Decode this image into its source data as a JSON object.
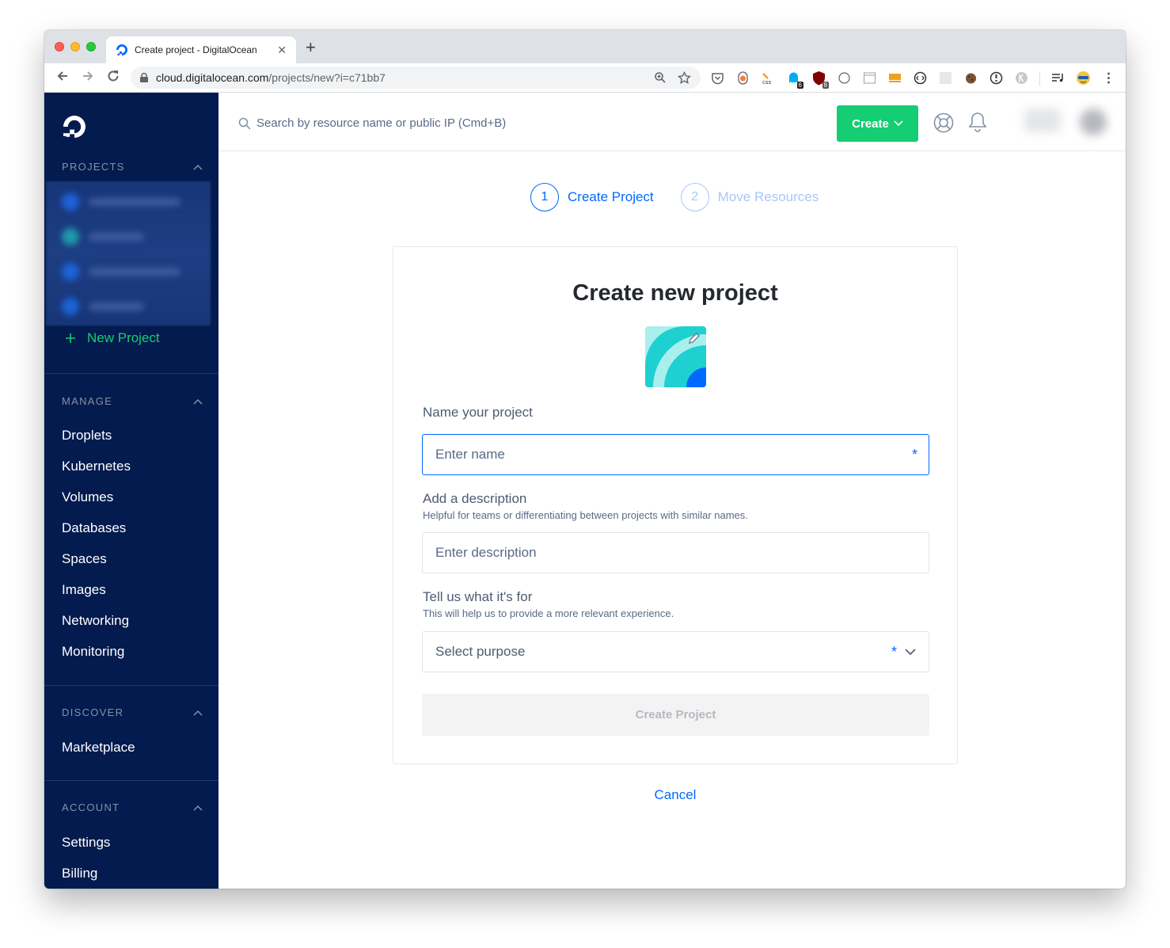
{
  "browser": {
    "tab_title": "Create project - DigitalOcean",
    "new_tab": "+",
    "close_tab": "✕",
    "url_host": "cloud.digitalocean.com",
    "url_path": "/projects/new?i=c71bb7",
    "ext_badge_6": "6",
    "ext_badge_8": "8"
  },
  "topbar": {
    "search_placeholder": "Search by resource name or public IP (Cmd+B)",
    "create_label": "Create"
  },
  "sidebar": {
    "projects_heading": "PROJECTS",
    "new_project_label": "New Project",
    "manage_heading": "MANAGE",
    "manage_items": [
      "Droplets",
      "Kubernetes",
      "Volumes",
      "Databases",
      "Spaces",
      "Images",
      "Networking",
      "Monitoring"
    ],
    "discover_heading": "DISCOVER",
    "discover_items": [
      "Marketplace"
    ],
    "account_heading": "ACCOUNT",
    "account_items": [
      "Settings",
      "Billing"
    ]
  },
  "stepper": {
    "steps": [
      {
        "number": "1",
        "label": "Create Project"
      },
      {
        "number": "2",
        "label": "Move Resources"
      }
    ]
  },
  "form": {
    "title": "Create new project",
    "name_label": "Name your project",
    "name_placeholder": "Enter name",
    "required_mark": "*",
    "description_label": "Add a description",
    "description_help": "Helpful for teams or differentiating between projects with similar names.",
    "description_placeholder": "Enter description",
    "purpose_label": "Tell us what it's for",
    "purpose_help": "This will help us to provide a more relevant experience.",
    "purpose_value": "Select purpose",
    "submit_label": "Create Project",
    "cancel_label": "Cancel"
  },
  "colors": {
    "sidebar_bg": "#031b4e",
    "accent_blue": "#0069ff",
    "create_green": "#15cd72",
    "new_project_green": "#15cd72"
  }
}
